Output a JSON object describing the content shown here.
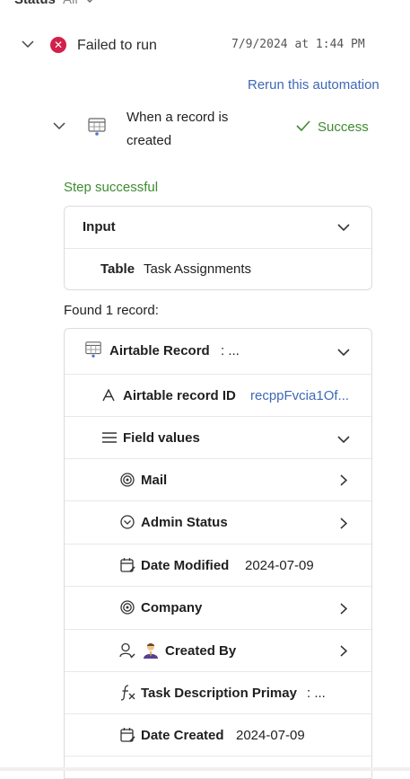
{
  "filter": {
    "label": "Status",
    "value": "All"
  },
  "run": {
    "status_label": "Failed to run",
    "timestamp": "7/9/2024 at 1:44 PM",
    "rerun_label": "Rerun this automation"
  },
  "trigger": {
    "title": "When a record is created",
    "status": "Success"
  },
  "step_message": "Step successful",
  "input": {
    "header": "Input",
    "rows": [
      {
        "label": "Table",
        "value": "Task Assignments"
      }
    ]
  },
  "found_text": "Found 1 record:",
  "record": {
    "header": "Airtable Record",
    "header_suffix": ": ...",
    "id_label": "Airtable record ID",
    "id_value": "recppFvcia1Of...",
    "field_values_label": "Field values",
    "fields": [
      {
        "label": "Mail",
        "value": "",
        "icon": "spiral-icon",
        "expandable": true
      },
      {
        "label": "Admin Status",
        "value": "",
        "icon": "circle-chevron-icon",
        "expandable": true
      },
      {
        "label": "Date Modified",
        "value": "2024-07-09",
        "icon": "calendar-edit-icon",
        "expandable": false
      },
      {
        "label": "Company",
        "value": "",
        "icon": "spiral-icon",
        "expandable": true
      },
      {
        "label": "Created By",
        "value": "",
        "icon": "user-icon",
        "expandable": true
      },
      {
        "label": "Task Description Primay",
        "value": ": ...",
        "icon": "formula-icon",
        "expandable": false
      },
      {
        "label": "Date Created",
        "value": "2024-07-09",
        "icon": "calendar-edit-icon",
        "expandable": false
      }
    ]
  },
  "colors": {
    "error": "#d3204a",
    "success": "#3d8b2f",
    "link": "#3e69b6"
  }
}
